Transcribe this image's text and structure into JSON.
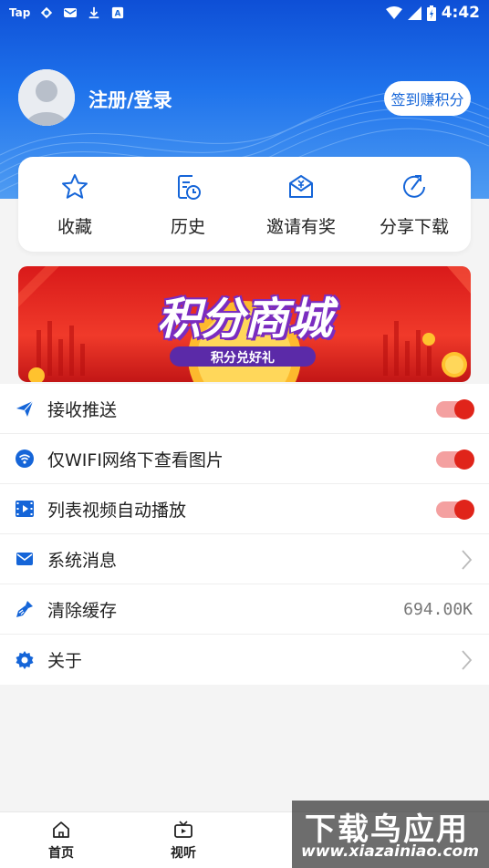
{
  "status_bar": {
    "time": "4:42",
    "left_icons": [
      "tap-icon",
      "sync-icon",
      "mail-icon",
      "download-icon",
      "a-icon"
    ],
    "right_icons": [
      "wifi-icon",
      "signal-icon",
      "battery-icon"
    ],
    "tap_label": "Tap"
  },
  "profile": {
    "login_label": "注册/登录",
    "signin_button": "签到赚积分"
  },
  "quick_actions": [
    {
      "label": "收藏",
      "icon": "star-icon"
    },
    {
      "label": "历史",
      "icon": "history-icon"
    },
    {
      "label": "邀请有奖",
      "icon": "invite-icon"
    },
    {
      "label": "分享下载",
      "icon": "share-icon"
    }
  ],
  "banner": {
    "title": "积分商城",
    "subtitle": "积分兑好礼"
  },
  "settings": [
    {
      "label": "接收推送",
      "icon": "send-icon",
      "control": "toggle",
      "on": true
    },
    {
      "label": "仅WIFI网络下查看图片",
      "icon": "wifi-circle-icon",
      "control": "toggle",
      "on": true
    },
    {
      "label": "列表视频自动播放",
      "icon": "video-icon",
      "control": "toggle",
      "on": true
    },
    {
      "label": "系统消息",
      "icon": "message-icon",
      "control": "chevron"
    },
    {
      "label": "清除缓存",
      "icon": "broom-icon",
      "control": "value",
      "value": "694.00K"
    },
    {
      "label": "关于",
      "icon": "gear-icon",
      "control": "chevron"
    }
  ],
  "bottom_nav": [
    {
      "label": "首页",
      "icon": "home-icon"
    },
    {
      "label": "视听",
      "icon": "tv-icon"
    }
  ],
  "watermark": {
    "title": "下载鸟应用",
    "url": "www.xiazainiao.com"
  },
  "colors": {
    "primary": "#1565d8",
    "toggle_on": "#e0241a",
    "banner_red": "#e0241a"
  }
}
